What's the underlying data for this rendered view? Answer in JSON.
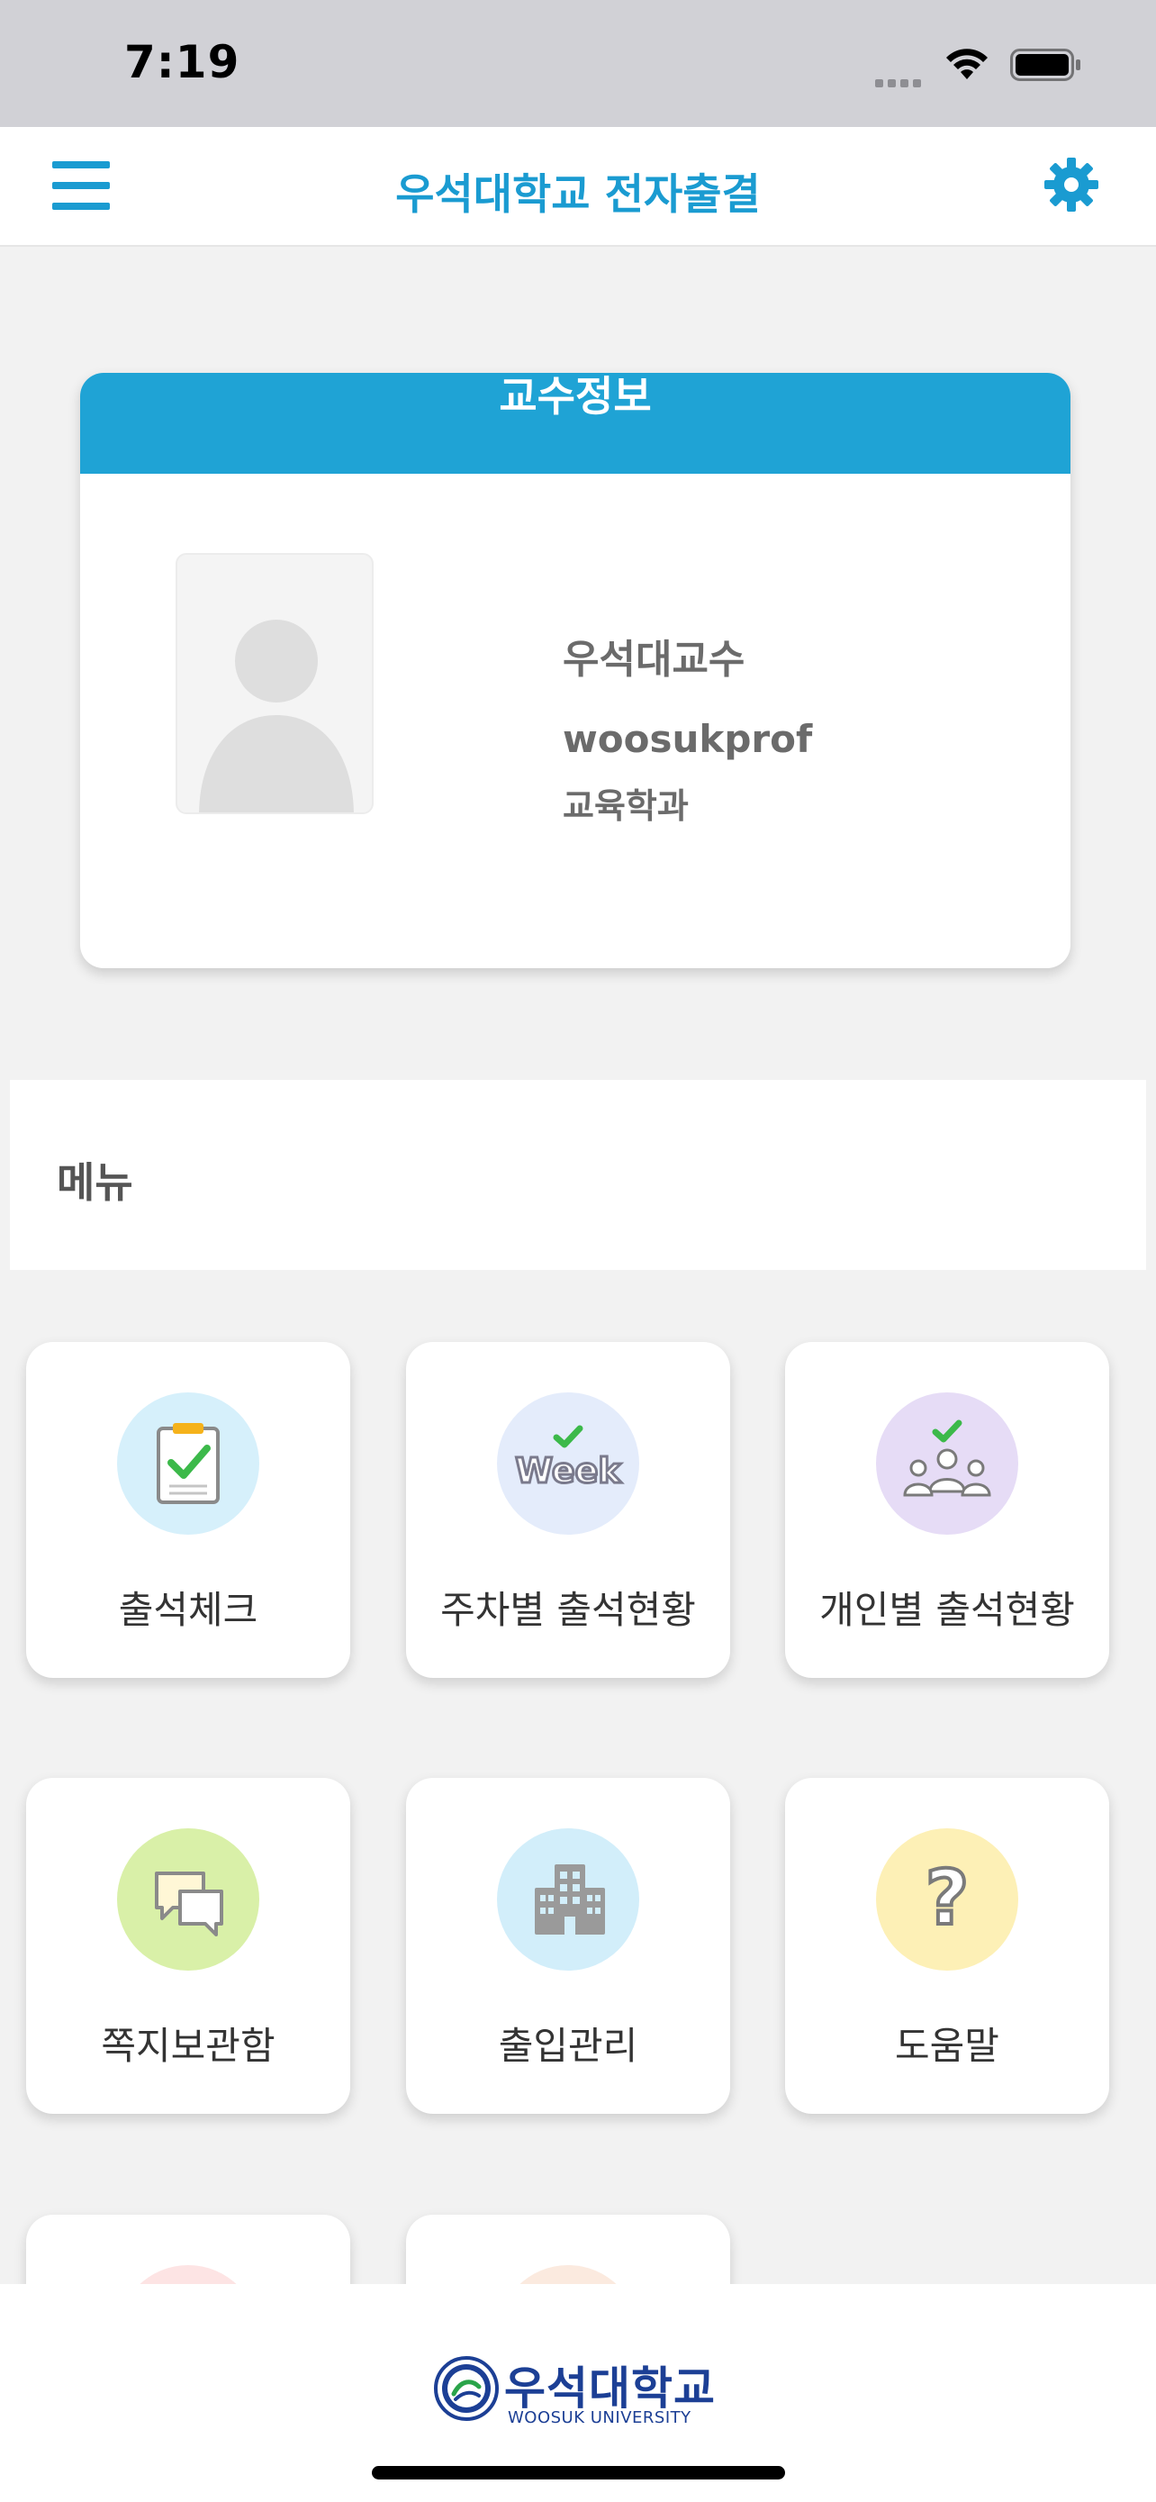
{
  "status_bar": {
    "time": "7:19"
  },
  "nav": {
    "title": "우석대학교 전자출결"
  },
  "professor": {
    "header": "교수정보",
    "name": "우석대교수",
    "id": "woosukprof",
    "department": "교육학과"
  },
  "menu": {
    "label": "메뉴",
    "items": [
      {
        "label": "출석체크",
        "icon": "clipboard-check-icon",
        "color": "#d6f0fb"
      },
      {
        "label": "주차별 출석현황",
        "icon": "week-check-icon",
        "color": "#e4ecfb"
      },
      {
        "label": "개인별 출석현황",
        "icon": "group-check-icon",
        "color": "#e6dcf6"
      },
      {
        "label": "쪽지보관함",
        "icon": "chat-bubbles-icon",
        "color": "#d9f0a8"
      },
      {
        "label": "출입관리",
        "icon": "building-icon",
        "color": "#d2eefa"
      },
      {
        "label": "도움말",
        "icon": "question-icon",
        "color": "#fdf0b6"
      }
    ]
  },
  "footer": {
    "logo_ko": "우석대학교",
    "logo_en": "WOOSUK UNIVERSITY"
  },
  "colors": {
    "accent": "#1a9bd1",
    "header_bg": "#1fa3d5",
    "logo": "#1c3f95"
  }
}
